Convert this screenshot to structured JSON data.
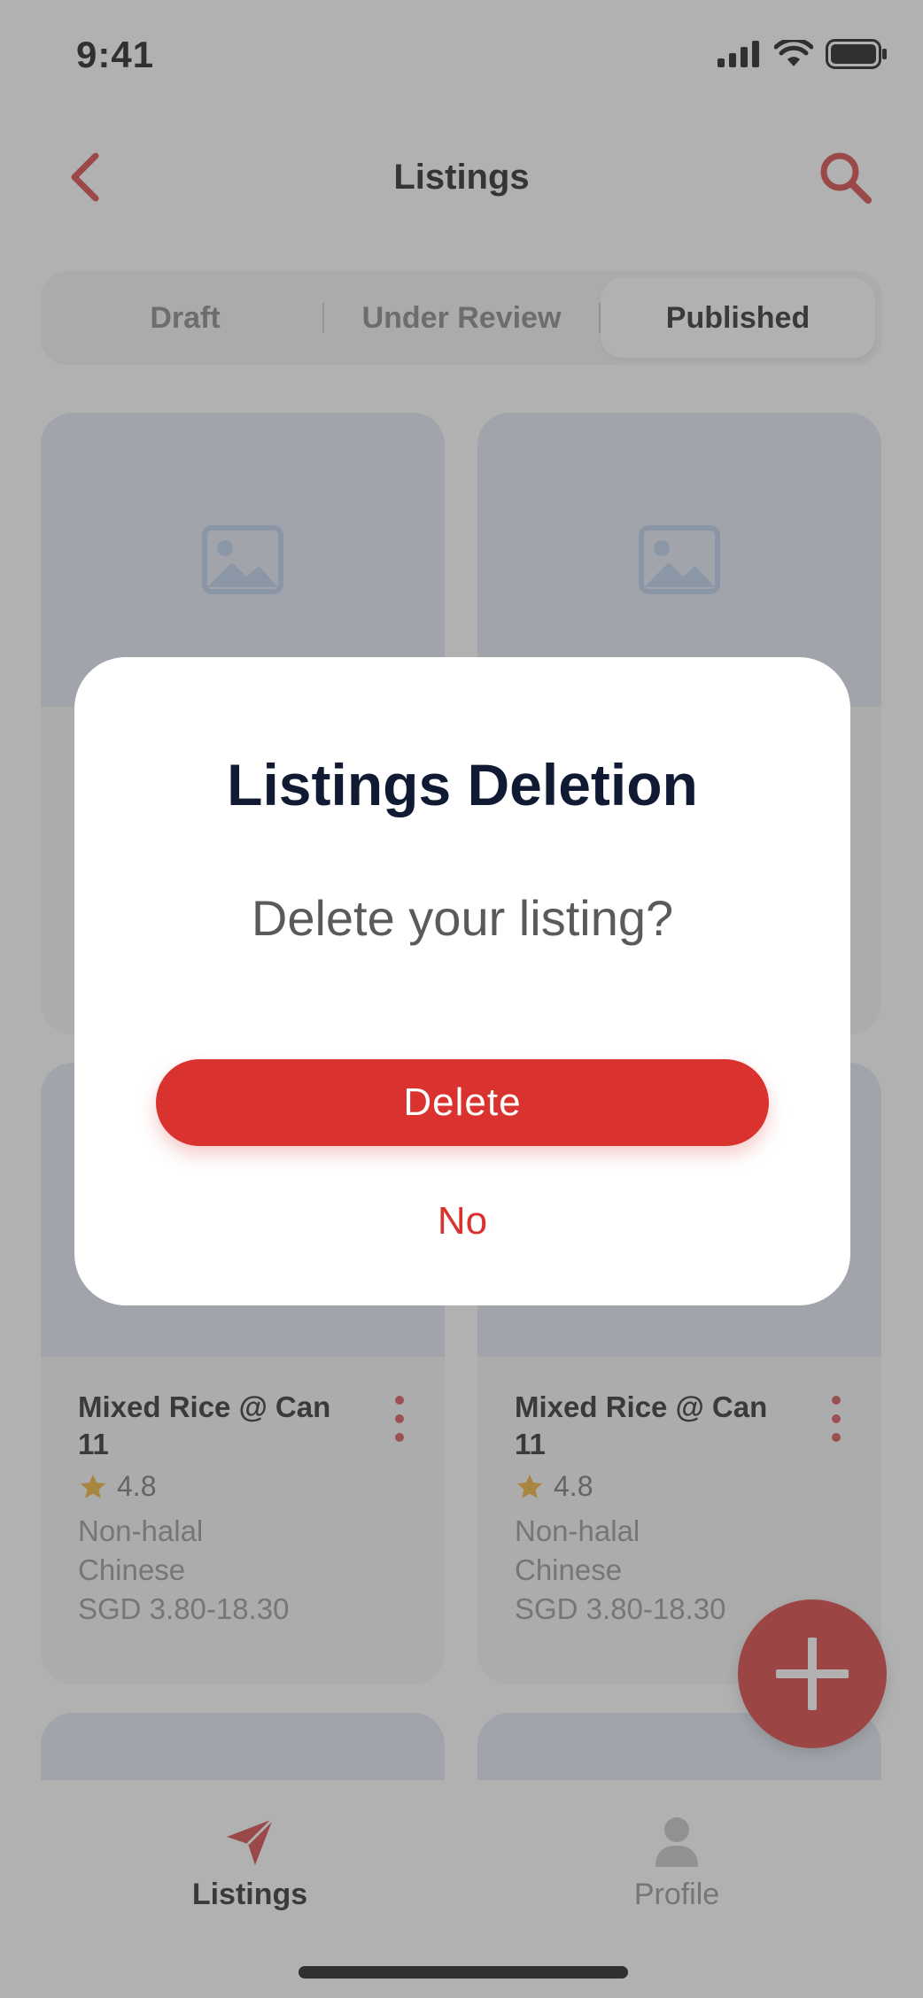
{
  "status_bar": {
    "time": "9:41"
  },
  "header": {
    "title": "Listings"
  },
  "tabs": [
    {
      "label": "Draft"
    },
    {
      "label": "Under Review"
    },
    {
      "label": "Published"
    }
  ],
  "cards": [
    {
      "title": "Mixed Rice @ Can 11",
      "rating": "4.8",
      "line1": "Non-halal",
      "line2": "Chinese",
      "price": "SGD 3.80-18.30"
    },
    {
      "title": "Mixed Rice @ Can 11",
      "rating": "4.8",
      "line1": "Non-halal",
      "line2": "Chinese",
      "price": "SGD 3.80-18.30"
    }
  ],
  "bottom_nav": {
    "listings_label": "Listings",
    "profile_label": "Profile"
  },
  "modal": {
    "title": "Listings Deletion",
    "message": "Delete your listing?",
    "delete_label": "Delete",
    "no_label": "No"
  },
  "colors": {
    "accent": "#d9322f",
    "overlay": "#464646"
  }
}
